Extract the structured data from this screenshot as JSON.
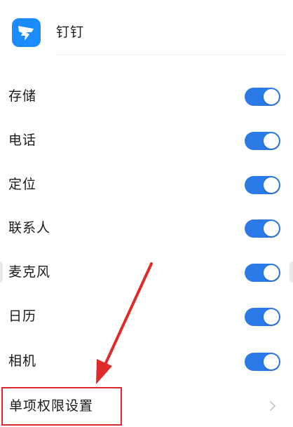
{
  "app": {
    "name": "钉钉",
    "icon": "dingtalk-logo-icon",
    "brand_color": "#1a8cff"
  },
  "permissions": [
    {
      "label": "存储",
      "enabled": true
    },
    {
      "label": "电话",
      "enabled": true
    },
    {
      "label": "定位",
      "enabled": true
    },
    {
      "label": "联系人",
      "enabled": true
    },
    {
      "label": "麦克风",
      "enabled": true
    },
    {
      "label": "日历",
      "enabled": true
    },
    {
      "label": "相机",
      "enabled": true
    }
  ],
  "single_permission_settings": {
    "label": "单项权限设置",
    "icon": "chevron-right-icon"
  },
  "colors": {
    "toggle_on": "#2a7be8",
    "annotation": "#e02a2a"
  }
}
